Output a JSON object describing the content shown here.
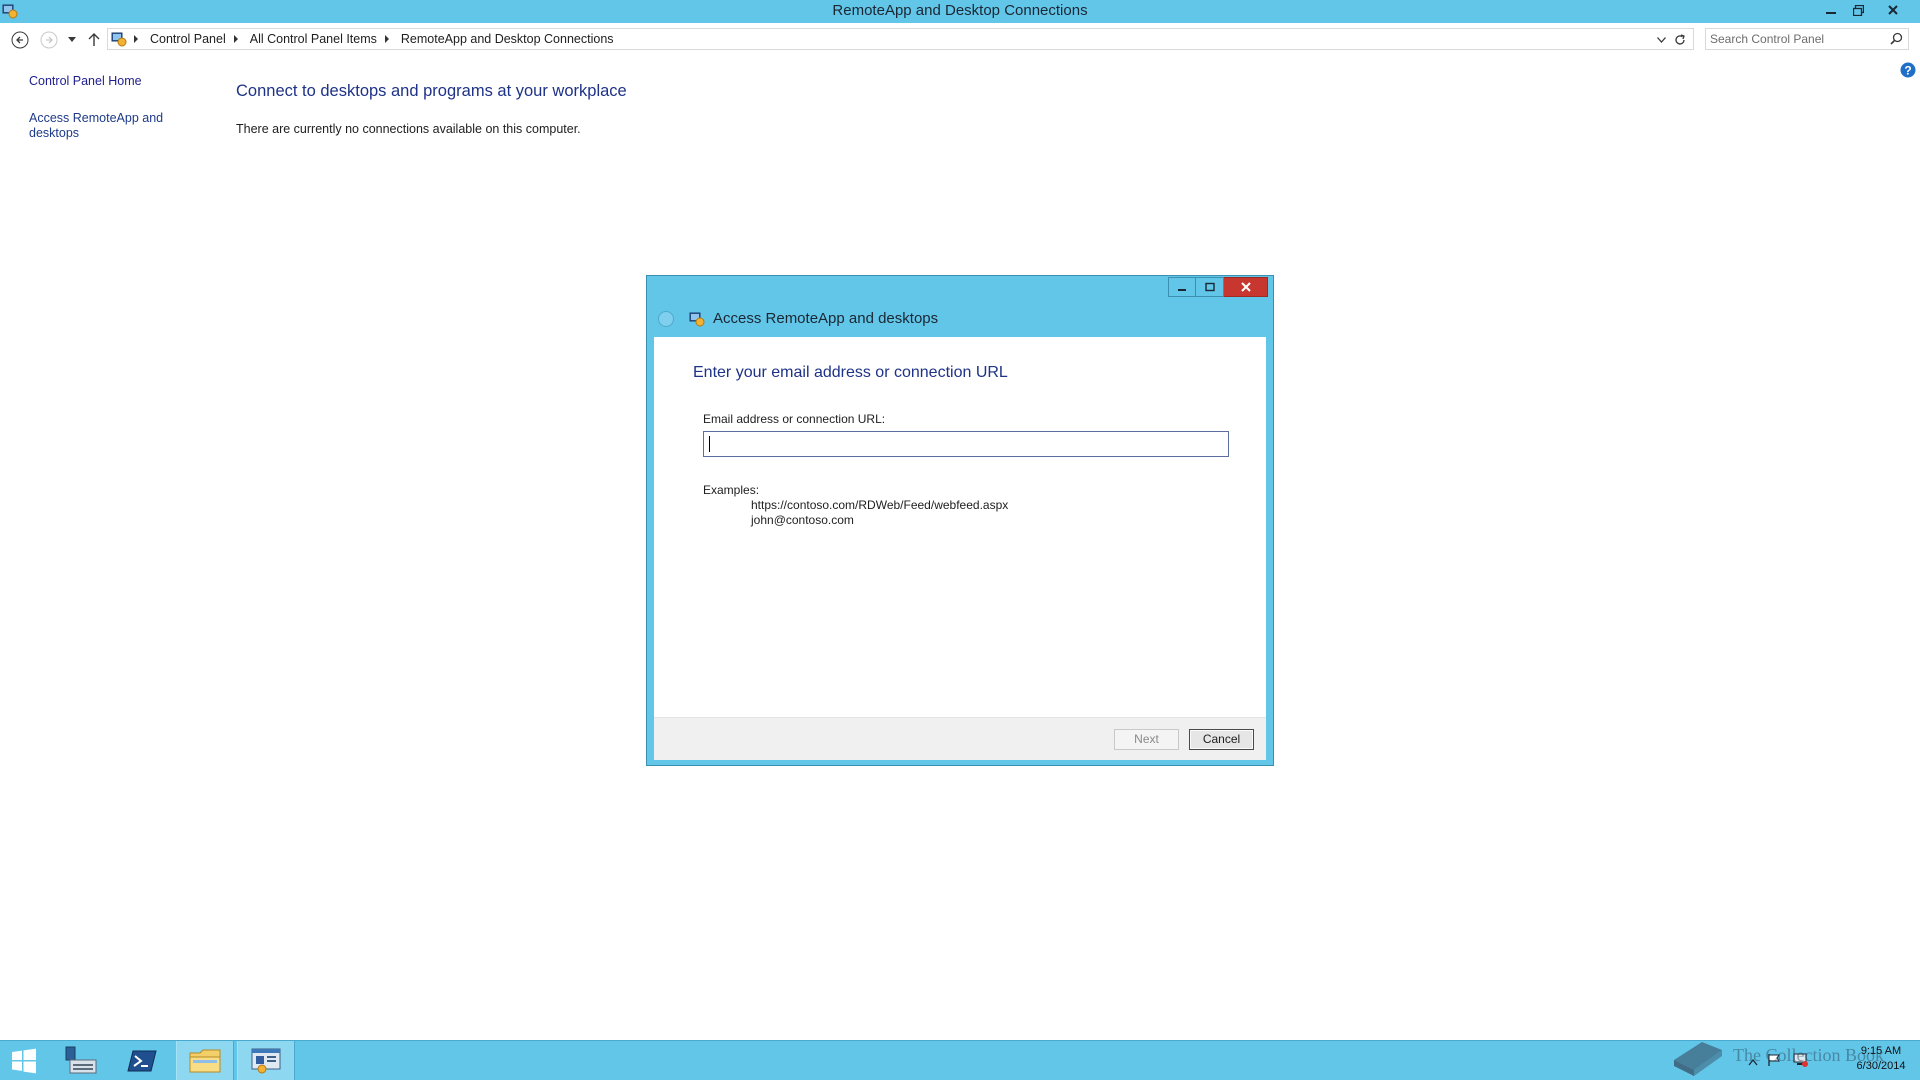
{
  "window": {
    "title": "RemoteApp and Desktop Connections",
    "controls": [
      "minimize",
      "restore",
      "close"
    ]
  },
  "navbar": {
    "breadcrumbs": [
      "Control Panel",
      "All Control Panel Items",
      "RemoteApp and Desktop Connections"
    ],
    "search_placeholder": "Search Control Panel"
  },
  "sidebar": {
    "home_link": "Control Panel Home",
    "access_link": "Access RemoteApp and desktops"
  },
  "main": {
    "heading": "Connect to desktops and programs at your workplace",
    "status_text": "There are currently no connections available on this computer."
  },
  "dialog": {
    "title": "Access RemoteApp and desktops",
    "heading": "Enter your email address or connection URL",
    "field_label": "Email address or connection URL:",
    "field_value": "",
    "examples_label": "Examples:",
    "examples": [
      "https://contoso.com/RDWeb/Feed/webfeed.aspx",
      "john@contoso.com"
    ],
    "next_label": "Next",
    "cancel_label": "Cancel",
    "next_enabled": false
  },
  "taskbar": {
    "items": [
      "start-button",
      "server-manager",
      "powershell",
      "file-explorer",
      "control-panel"
    ],
    "watermark": "The Collection Book",
    "clock_time": "9:15 AM",
    "clock_date": "6/30/2014"
  },
  "colors": {
    "titlebar": "#62c6e9",
    "heading_blue": "#1e3287",
    "close_red": "#c7372f"
  }
}
